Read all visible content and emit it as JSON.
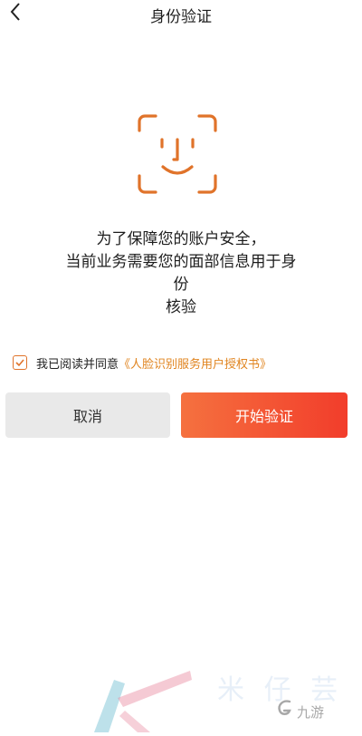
{
  "header": {
    "title": "身份验证",
    "back_icon": "chevron-left-icon"
  },
  "face_icon": {
    "name": "face-id-icon",
    "color": "#e0732a"
  },
  "message": {
    "line1": "为了保障您的账户安全，",
    "line2": "当前业务需要您的面部信息用于身份",
    "line3": "核验"
  },
  "agreement": {
    "checked": true,
    "prefix": "我已阅读并同意",
    "link": "《人脸识别服务用户授权书》",
    "link_color": "#e0841f"
  },
  "buttons": {
    "cancel_label": "取消",
    "start_label": "开始验证"
  },
  "watermark": {
    "brand": "九游"
  },
  "colors": {
    "accent": "#e0732a",
    "start_gradient_from": "#f5713f",
    "start_gradient_to": "#f23d2b",
    "cancel_bg": "#e9e9e9"
  }
}
